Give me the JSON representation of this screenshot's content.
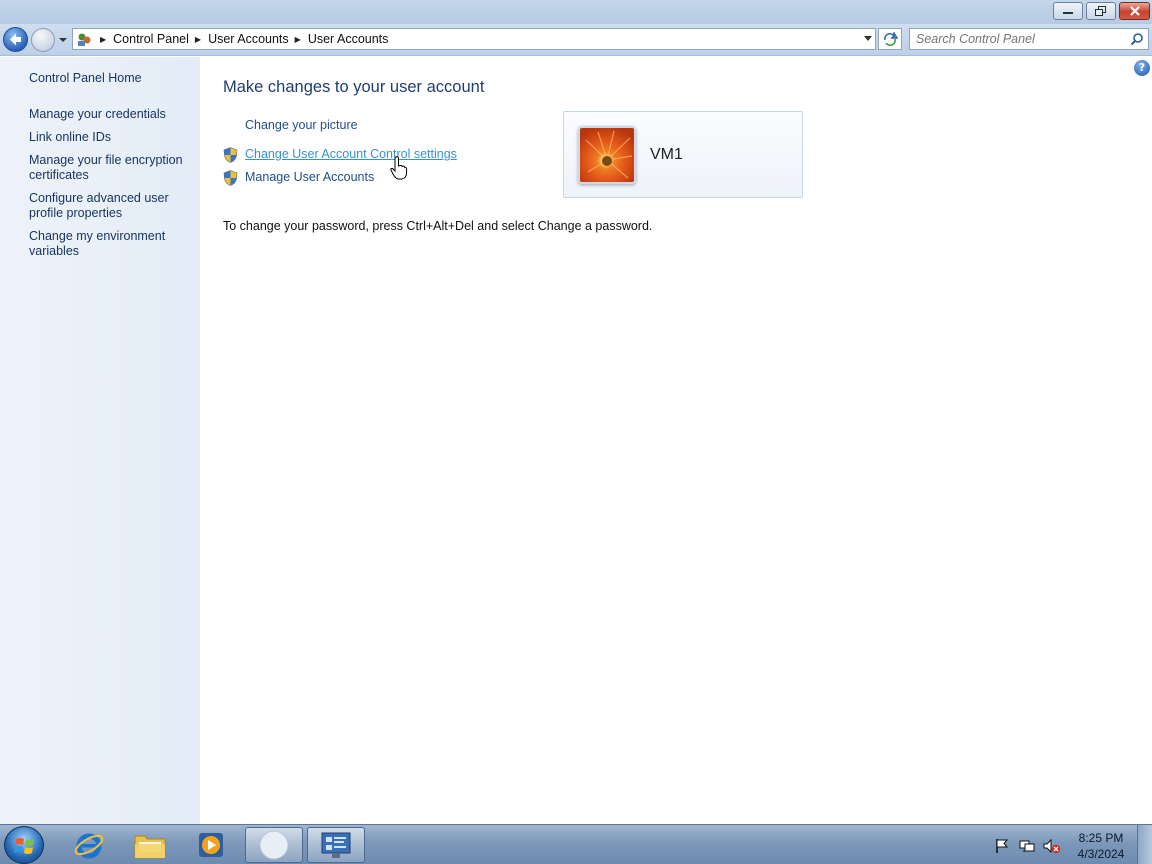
{
  "window": {
    "breadcrumb": [
      "Control Panel",
      "User Accounts",
      "User Accounts"
    ],
    "search_placeholder": "Search Control Panel"
  },
  "sidebar": {
    "home": "Control Panel Home",
    "links": [
      "Manage your credentials",
      "Link online IDs",
      "Manage your file encryption certificates",
      "Configure advanced user profile properties",
      "Change my environment variables"
    ]
  },
  "main": {
    "title": "Make changes to your user account",
    "tasks": [
      {
        "label": "Change your picture",
        "icon": "none"
      },
      {
        "label": "Change User Account Control settings",
        "icon": "uac-shield-icon"
      },
      {
        "label": "Manage User Accounts",
        "icon": "uac-shield-icon"
      }
    ],
    "account_name": "VM1",
    "password_note": "To change your password, press Ctrl+Alt+Del and select Change a password."
  },
  "taskbar": {
    "pinned": [
      "internet-explorer-icon",
      "windows-explorer-icon",
      "media-player-icon",
      "blank-window-icon",
      "control-panel-icon"
    ],
    "clock_time": "8:25 PM",
    "clock_date": "4/3/2024"
  },
  "colors": {
    "link": "#1f4e8c",
    "link_hover": "#3a8fd6",
    "title": "#1e3d73",
    "sidebar_bg": "#e8eff8"
  }
}
